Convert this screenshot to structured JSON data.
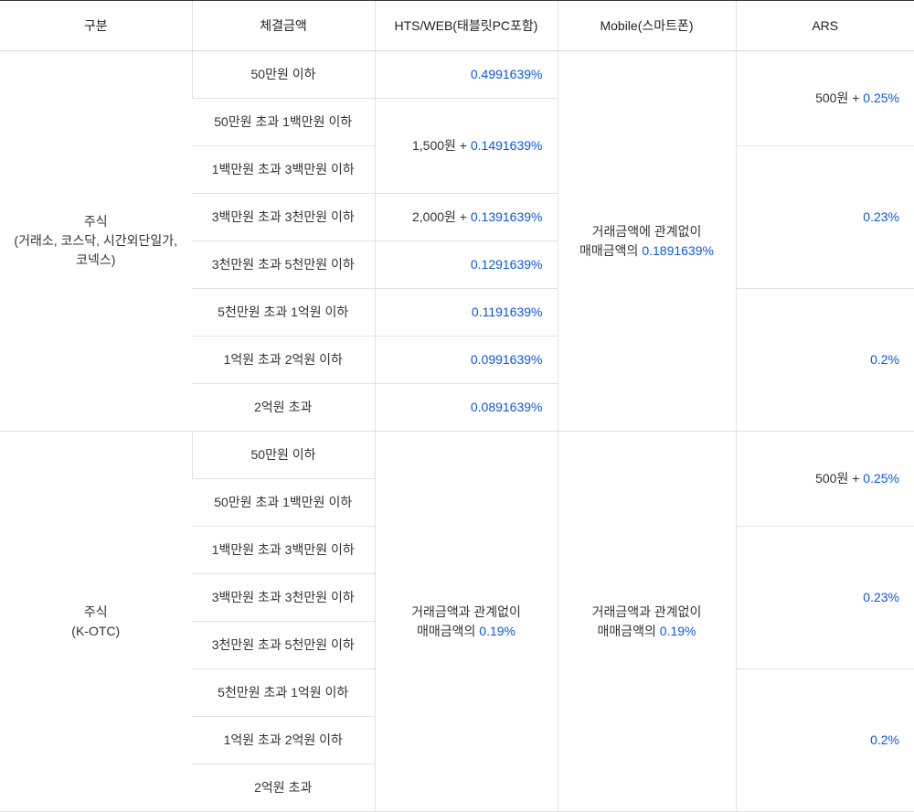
{
  "headers": {
    "col1": "구분",
    "col2": "체결금액",
    "col3": "HTS/WEB(태블릿PC포함)",
    "col4": "Mobile(스마트폰)",
    "col5": "ARS"
  },
  "section1": {
    "title_line1": "주식",
    "title_line2": "(거래소, 코스닥, 시간외단일가, 코넥스)",
    "rows": {
      "r1_amount": "50만원 이하",
      "r1_hts": "0.4991639%",
      "r2_amount": "50만원 초과 1백만원 이하",
      "r3_amount": "1백만원 초과 3백만원 이하",
      "r4_amount": "3백만원 초과 3천만원 이하",
      "r5_amount": "3천만원 초과 5천만원 이하",
      "r5_hts": "0.1291639%",
      "r6_amount": "5천만원 초과 1억원 이하",
      "r6_hts": "0.1191639%",
      "r7_amount": "1억원 초과 2억원 이하",
      "r7_hts": "0.0991639%",
      "r8_amount": "2억원 초과",
      "r8_hts": "0.0891639%"
    },
    "hts_r23_prefix": "1,500원 + ",
    "hts_r23_blue": "0.1491639%",
    "hts_r4_prefix": "2,000원 + ",
    "hts_r4_blue": "0.1391639%",
    "mobile_line1": "거래금액에 관계없이",
    "mobile_line2a": "매매금액의 ",
    "mobile_line2b": "0.1891639%",
    "ars_r12_prefix": "500원 + ",
    "ars_r12_blue": "0.25%",
    "ars_r345": "0.23%",
    "ars_r678": "0.2%"
  },
  "section2": {
    "title_line1": "주식",
    "title_line2": "(K-OTC)",
    "rows": {
      "r1_amount": "50만원 이하",
      "r2_amount": "50만원 초과 1백만원 이하",
      "r3_amount": "1백만원 초과 3백만원 이하",
      "r4_amount": "3백만원 초과 3천만원 이하",
      "r5_amount": "3천만원 초과 5천만원 이하",
      "r6_amount": "5천만원 초과 1억원 이하",
      "r7_amount": "1억원 초과 2억원 이하",
      "r8_amount": "2억원 초과"
    },
    "hts_line1": "거래금액과 관계없이",
    "hts_line2a": "매매금액의 ",
    "hts_line2b": "0.19%",
    "mobile_line1": "거래금액과 관계없이",
    "mobile_line2a": "매매금액의 ",
    "mobile_line2b": "0.19%",
    "ars_r12_prefix": "500원 + ",
    "ars_r12_blue": "0.25%",
    "ars_r345": "0.23%",
    "ars_r678": "0.2%"
  }
}
